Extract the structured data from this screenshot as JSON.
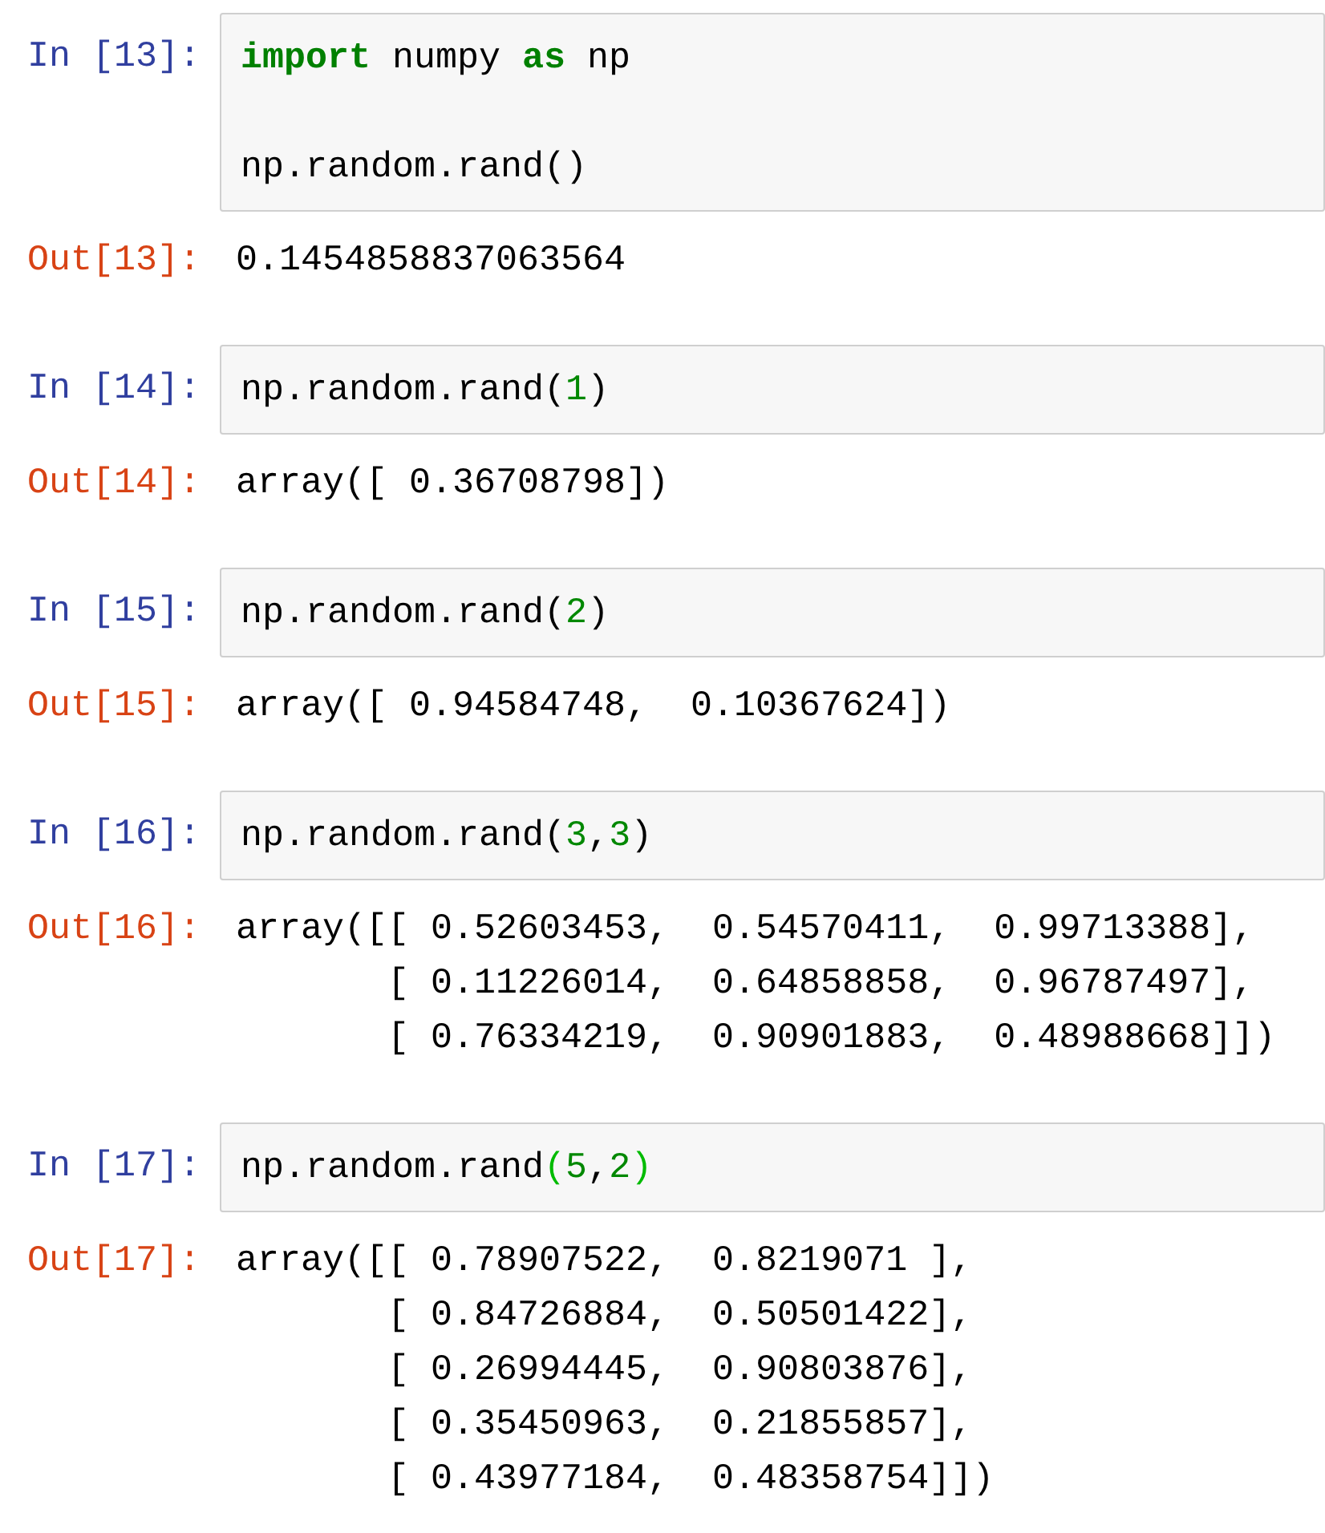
{
  "cells": [
    {
      "in_prompt": "In [13]:",
      "code": [
        {
          "tokens": [
            {
              "kind": "keyword",
              "text": "import"
            },
            {
              "kind": "plain",
              "text": " numpy "
            },
            {
              "kind": "keyword",
              "text": "as"
            },
            {
              "kind": "plain",
              "text": " np"
            }
          ]
        },
        {
          "blank": true
        },
        {
          "tokens": [
            {
              "kind": "plain",
              "text": "np.random.rand()"
            }
          ]
        }
      ],
      "out_prompt": "Out[13]:",
      "output": [
        "0.1454858837063564"
      ]
    },
    {
      "in_prompt": "In [14]:",
      "code": [
        {
          "tokens": [
            {
              "kind": "plain",
              "text": "np.random.rand("
            },
            {
              "kind": "number",
              "text": "1"
            },
            {
              "kind": "plain",
              "text": ")"
            }
          ]
        }
      ],
      "out_prompt": "Out[14]:",
      "output": [
        "array([ 0.36708798])"
      ]
    },
    {
      "in_prompt": "In [15]:",
      "code": [
        {
          "tokens": [
            {
              "kind": "plain",
              "text": "np.random.rand("
            },
            {
              "kind": "number",
              "text": "2"
            },
            {
              "kind": "plain",
              "text": ")"
            }
          ]
        }
      ],
      "out_prompt": "Out[15]:",
      "output": [
        "array([ 0.94584748,  0.10367624])"
      ]
    },
    {
      "in_prompt": "In [16]:",
      "code": [
        {
          "tokens": [
            {
              "kind": "plain",
              "text": "np.random.rand("
            },
            {
              "kind": "number",
              "text": "3"
            },
            {
              "kind": "plain",
              "text": ","
            },
            {
              "kind": "number",
              "text": "3"
            },
            {
              "kind": "plain",
              "text": ")"
            }
          ]
        }
      ],
      "out_prompt": "Out[16]:",
      "output": [
        "array([[ 0.52603453,  0.54570411,  0.99713388],",
        "       [ 0.11226014,  0.64858858,  0.96787497],",
        "       [ 0.76334219,  0.90901883,  0.48988668]])"
      ]
    },
    {
      "in_prompt": "In [17]:",
      "code": [
        {
          "tokens": [
            {
              "kind": "plain",
              "text": "np.random.rand"
            },
            {
              "kind": "bracket-match",
              "text": "("
            },
            {
              "kind": "number",
              "text": "5"
            },
            {
              "kind": "plain",
              "text": ","
            },
            {
              "kind": "number",
              "text": "2"
            },
            {
              "kind": "bracket-match",
              "text": ")"
            }
          ]
        }
      ],
      "out_prompt": "Out[17]:",
      "output": [
        "array([[ 0.78907522,  0.8219071 ],",
        "       [ 0.84726884,  0.50501422],",
        "       [ 0.26994445,  0.90803876],",
        "       [ 0.35450963,  0.21855857],",
        "       [ 0.43977184,  0.48358754]])"
      ]
    }
  ]
}
